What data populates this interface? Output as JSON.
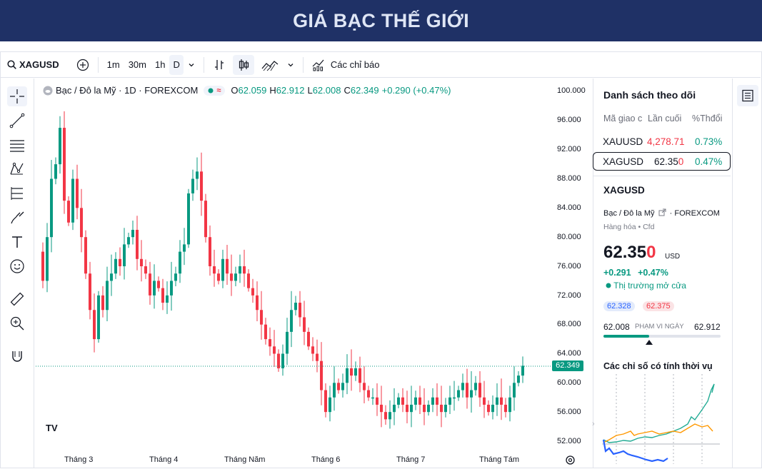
{
  "banner": {
    "title": "GIÁ BẠC THẾ GIỚI"
  },
  "toolbar": {
    "symbol": "XAGUSD",
    "intervals": [
      "1m",
      "30m",
      "1h",
      "D"
    ],
    "indicators_label": "Các chỉ báo"
  },
  "legend": {
    "name": "Bạc / Đô la Mỹ · 1D · FOREXCOM",
    "open_label": "O",
    "open": "62.059",
    "high_label": "H",
    "high": "62.912",
    "low_label": "L",
    "low": "62.008",
    "close_label": "C",
    "close": "62.349",
    "change": "+0.290 (+0.47%)"
  },
  "chart": {
    "last_price_tag": "62.349",
    "x_ticks": [
      "Tháng 3",
      "Tháng 4",
      "Tháng Năm",
      "Tháng 6",
      "Tháng 7",
      "Tháng Tám"
    ],
    "y_ticks": [
      "100.000",
      "96.000",
      "92.000",
      "88.000",
      "84.000",
      "80.000",
      "76.000",
      "72.000",
      "68.000",
      "64.000",
      "60.000",
      "56.000",
      "52.000"
    ],
    "tv_logo": "TV",
    "colors": {
      "up": "#089981",
      "down": "#f23645"
    }
  },
  "watchlist": {
    "title": "Danh sách theo dõi",
    "headers": [
      "Mã giao c",
      "Lần cuối",
      "%Thđổi"
    ],
    "rows": [
      {
        "symbol": "XAUUSD",
        "last": "4,278.71",
        "change": "0.73%"
      },
      {
        "symbol": "XAGUSD",
        "last_main": "62.35",
        "last_tail": "0",
        "change": "0.47%"
      }
    ]
  },
  "detail": {
    "symbol": "XAGUSD",
    "description": "Bạc / Đô la Mỹ",
    "exchange": "FOREXCOM",
    "category": "Hàng hóa",
    "type": "Cfd",
    "price_main": "62.35",
    "price_tail": "0",
    "currency": "USD",
    "change": "+0.291",
    "change_pct": "+0.47%",
    "market_status": "Thị trường mở cửa",
    "bid": "62.328",
    "ask": "62.375",
    "range_low": "62.008",
    "range_label": "PHẠM VI NGÀY",
    "range_high": "62.912",
    "seasonal_title": "Các chỉ số có tính thời vụ"
  }
}
